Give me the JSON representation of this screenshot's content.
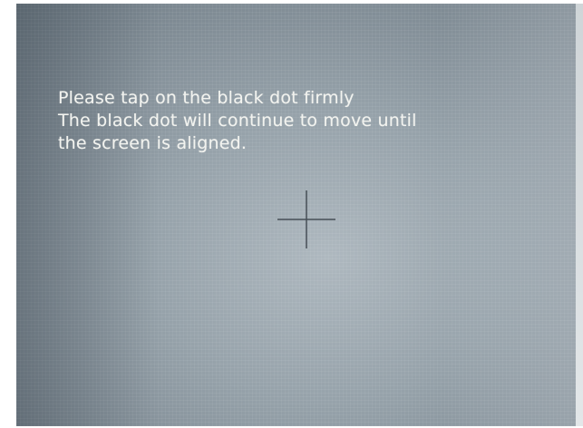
{
  "screen": {
    "instruction_lines": [
      "Please tap on the black dot firmly",
      "The black dot will continue to move until",
      "the screen is aligned."
    ],
    "target_icon": "crosshair-icon"
  }
}
